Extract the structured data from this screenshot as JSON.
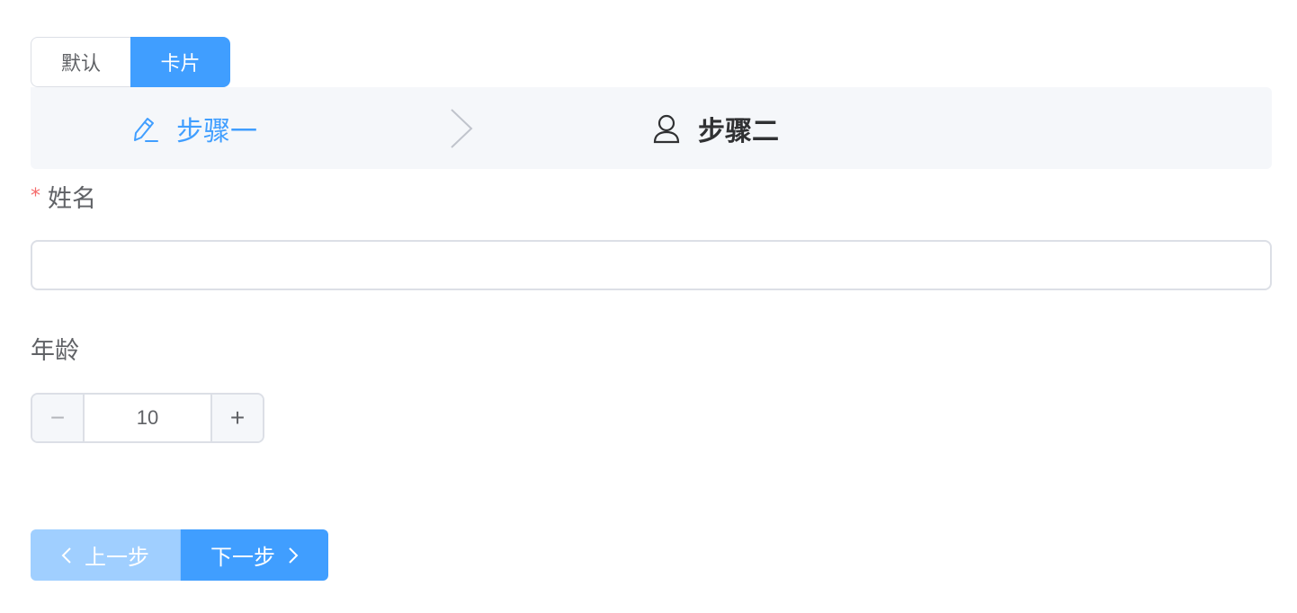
{
  "style_toggle": {
    "default_label": "默认",
    "card_label": "卡片",
    "selected": "卡片"
  },
  "steps": [
    {
      "label": "步骤一",
      "icon": "edit-pen-icon",
      "state": "active"
    },
    {
      "label": "步骤二",
      "icon": "user-icon",
      "state": "current"
    }
  ],
  "separator_icon": "chevron-right-icon",
  "form": {
    "name": {
      "label": "姓名",
      "required_mark": "*",
      "value": "",
      "placeholder": ""
    },
    "age": {
      "label": "年龄",
      "value": "10",
      "decrement": "−",
      "increment": "+"
    }
  },
  "nav": {
    "prev_label": "上一步",
    "next_label": "下一步",
    "prev_disabled": true
  },
  "colors": {
    "primary": "#409eff",
    "primary_light": "#a0cfff",
    "step_bar_bg": "#f5f7fa",
    "required": "#f56c6c"
  }
}
